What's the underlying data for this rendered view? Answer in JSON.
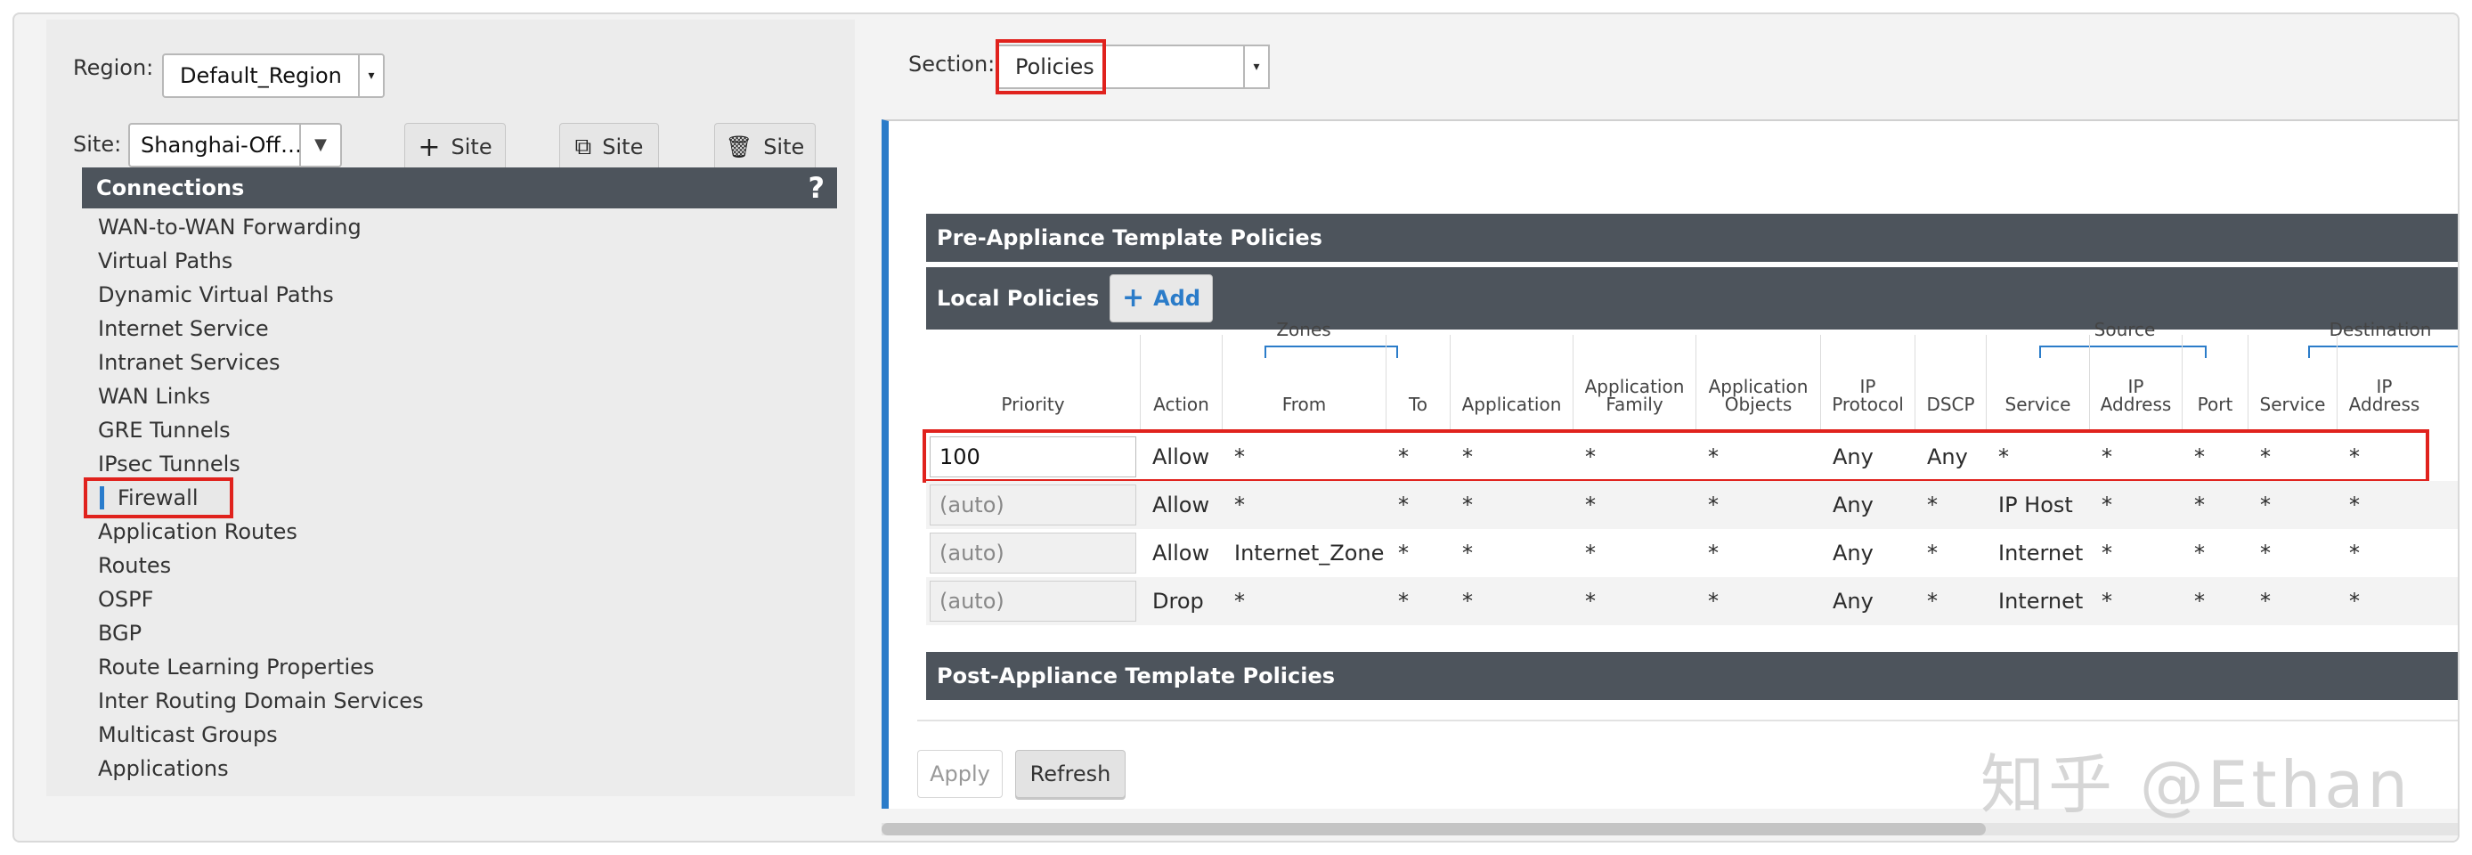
{
  "region": {
    "label": "Region:",
    "value": "Default_Region"
  },
  "site": {
    "label": "Site:",
    "value": "Shanghai-Off…"
  },
  "site_buttons": [
    {
      "icon": "plus-icon",
      "glyph": "+",
      "label": "Site"
    },
    {
      "icon": "copy-icon",
      "glyph": "⧉",
      "label": "Site"
    },
    {
      "icon": "trash-icon",
      "glyph": "🗑",
      "label": "Site"
    }
  ],
  "connections": {
    "title": "Connections",
    "help": "?",
    "items": [
      "WAN-to-WAN Forwarding",
      "Virtual Paths",
      "Dynamic Virtual Paths",
      "Internet Service",
      "Intranet Services",
      "WAN Links",
      "GRE Tunnels",
      "IPsec Tunnels",
      "Firewall",
      "Application Routes",
      "Routes",
      "OSPF",
      "BGP",
      "Route Learning Properties",
      "Inter Routing Domain Services",
      "Multicast Groups",
      "Applications"
    ],
    "active_index": 8
  },
  "section": {
    "label": "Section:",
    "value": "Policies"
  },
  "bars": {
    "pre": "Pre-Appliance Template Policies",
    "local": "Local Policies",
    "add": "Add",
    "post": "Post-Appliance Template Policies"
  },
  "groups": {
    "zones": "Zones",
    "source": "Source",
    "destination": "Destination"
  },
  "columns": {
    "priority": "Priority",
    "action": "Action",
    "from": "From",
    "to": "To",
    "application": "Application",
    "app_family_1": "Application",
    "app_family_2": "Family",
    "app_objects_1": "Application",
    "app_objects_2": "Objects",
    "ip_protocol_1": "IP",
    "ip_protocol_2": "Protocol",
    "dscp": "DSCP",
    "src_service": "Service",
    "src_ip_1": "IP",
    "src_ip_2": "Address",
    "src_port": "Port",
    "dst_service": "Service",
    "dst_ip_1": "IP",
    "dst_ip_2": "Address"
  },
  "rows": [
    {
      "priority": "100",
      "action": "Allow",
      "from": "*",
      "to": "*",
      "application": "*",
      "family": "*",
      "objects": "*",
      "protocol": "Any",
      "dscp": "Any",
      "src_service": "*",
      "src_ip": "*",
      "src_port": "*",
      "dst_service": "*",
      "dst_ip": "*"
    },
    {
      "priority": "(auto)",
      "action": "Allow",
      "from": "*",
      "to": "*",
      "application": "*",
      "family": "*",
      "objects": "*",
      "protocol": "Any",
      "dscp": "*",
      "src_service": "IP Host",
      "src_ip": "*",
      "src_port": "*",
      "dst_service": "*",
      "dst_ip": "*"
    },
    {
      "priority": "(auto)",
      "action": "Allow",
      "from": "Internet_Zone",
      "to": "*",
      "application": "*",
      "family": "*",
      "objects": "*",
      "protocol": "Any",
      "dscp": "*",
      "src_service": "Internet",
      "src_ip": "*",
      "src_port": "*",
      "dst_service": "*",
      "dst_ip": "*"
    },
    {
      "priority": "(auto)",
      "action": "Drop",
      "from": "*",
      "to": "*",
      "application": "*",
      "family": "*",
      "objects": "*",
      "protocol": "Any",
      "dscp": "*",
      "src_service": "Internet",
      "src_ip": "*",
      "src_port": "*",
      "dst_service": "*",
      "dst_ip": "*"
    }
  ],
  "footer": {
    "apply": "Apply",
    "refresh": "Refresh"
  },
  "watermark": "知乎 @Ethan",
  "colors": {
    "header_bg": "#4d545c",
    "accent": "#2b7cc9",
    "highlight": "#e0221d"
  }
}
